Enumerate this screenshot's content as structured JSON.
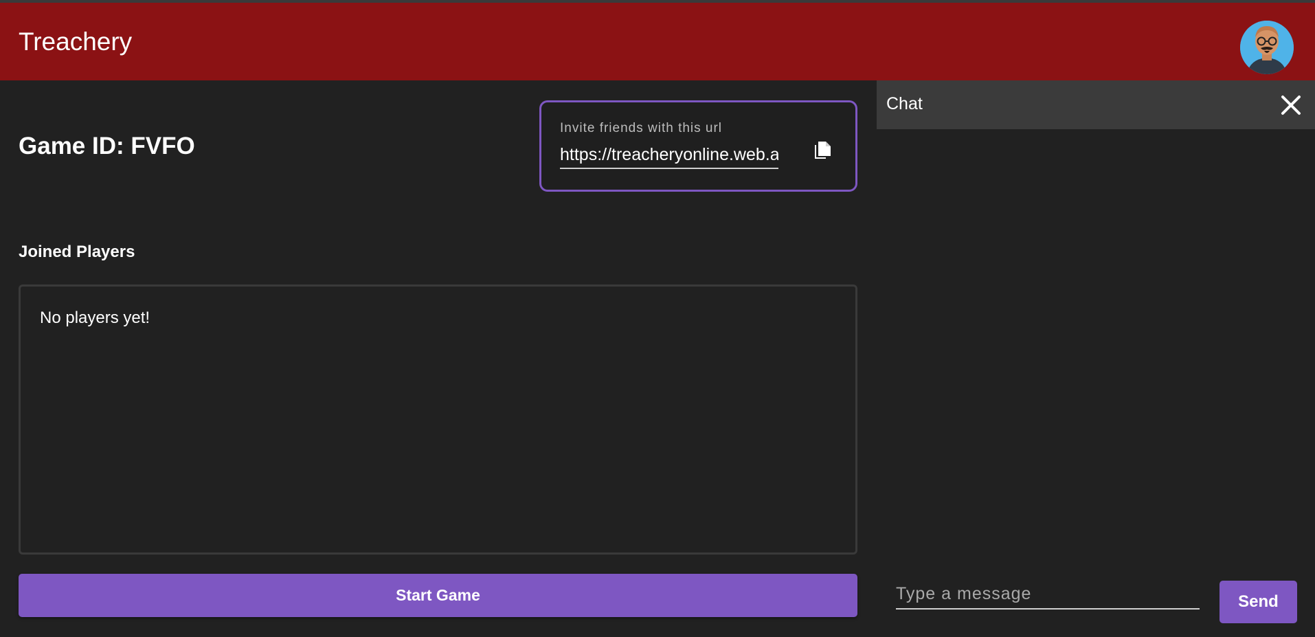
{
  "app": {
    "title": "Treachery",
    "accent_color": "#8b1214",
    "primary_color": "#7e57c2",
    "avatar_icon": "user-avatar"
  },
  "lobby": {
    "game_id_text": "Game ID: FVFO",
    "invite": {
      "label": "Invite friends with this url",
      "url_value": "https://treacheryonline.web.a",
      "copy_icon": "copy-icon"
    },
    "players": {
      "title": "Joined Players",
      "empty_text": "No players yet!"
    },
    "start_button_label": "Start Game"
  },
  "chat": {
    "title": "Chat",
    "close_icon": "close-icon",
    "input_placeholder": "Type a message",
    "send_label": "Send"
  }
}
